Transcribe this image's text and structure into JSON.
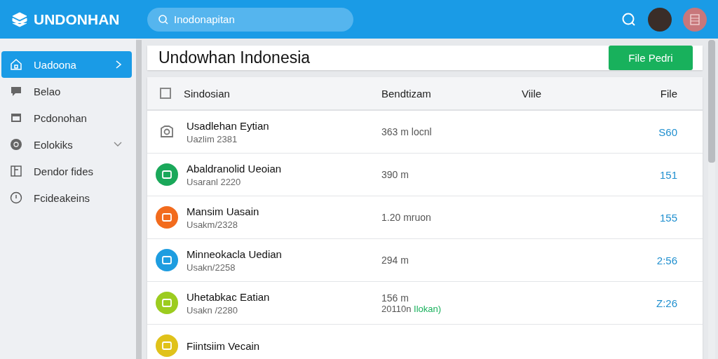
{
  "app": {
    "name": "UNDONHAN"
  },
  "search": {
    "value": "Inodonapitan"
  },
  "sidebar": {
    "items": [
      {
        "label": "Uadoona",
        "selected": true
      },
      {
        "label": "Belao",
        "selected": false
      },
      {
        "label": "Pcdonohan",
        "selected": false
      },
      {
        "label": "Eolokiks",
        "selected": false,
        "expanded": false
      },
      {
        "label": "Dendor fides",
        "selected": false
      },
      {
        "label": "Fcideakeins",
        "selected": false
      }
    ]
  },
  "page": {
    "title": "Undowhan Indonesia",
    "action": "File Pedri"
  },
  "table": {
    "select_all": {
      "checked": false
    },
    "columns": [
      "Sindosian",
      "Bendtizam",
      "Viile",
      "File"
    ],
    "rows": [
      {
        "name": "Usadlehan Eytian",
        "sub": "Uazlim 2381",
        "distance": "363 m locnl",
        "value": "S60",
        "kind": "outline",
        "color": "#777777"
      },
      {
        "name": "Abaldranolid Ueoian",
        "sub": "Usaranl 2220",
        "distance": "390 m",
        "value": "151",
        "kind": "badge",
        "color": "#1aa85a"
      },
      {
        "name": "Mansim Uasain",
        "sub": "Usakm/2328",
        "distance": "1.20 mruon",
        "value": "155",
        "kind": "badge",
        "color": "#f26b1d"
      },
      {
        "name": "Minneokacla Uedian",
        "sub": "Usakn/2258",
        "distance": "294 m",
        "value": "2:56",
        "kind": "badge",
        "color": "#1e9de0"
      },
      {
        "name": "Uhetabkac Eatian",
        "sub": "Usakn /2280",
        "distance": "156 m",
        "note": "20110n",
        "note_tag": "Ilokan)",
        "value": "Z:26",
        "kind": "badge",
        "color": "#9ccc1f"
      },
      {
        "name": "Fiintsiim Vecain",
        "kind": "badge",
        "color": "#e0c21a"
      }
    ]
  }
}
